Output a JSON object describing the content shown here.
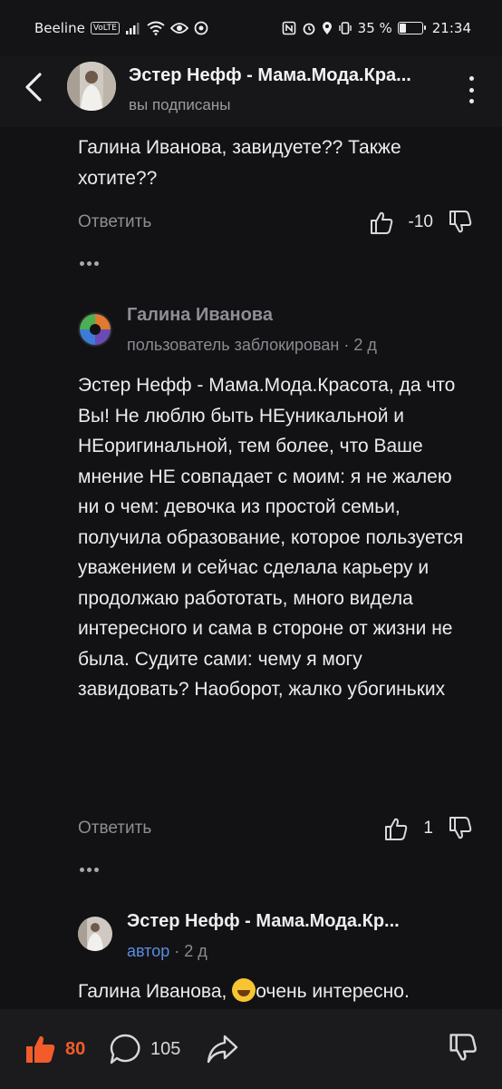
{
  "status": {
    "carrier": "Beeline",
    "volte": "VoLTE",
    "battery_percent_label": "35 %",
    "battery_level": 0.35,
    "time": "21:34"
  },
  "header": {
    "title": "Эстер Нефф - Мама.Мода.Кра...",
    "subtitle": "вы подписаны"
  },
  "comments": [
    {
      "text": "Галина Иванова, завидуете?? Также хотите??",
      "reply_label": "Ответить",
      "rating": "-10"
    },
    {
      "author": "Галина Иванова",
      "meta_status": "пользователь заблокирован",
      "meta_time": "· 2 д",
      "text": "Эстер Нефф - Мама.Мода.Красота, да что Вы! Не люблю быть НЕуникальной и НЕоригинальной, тем более, что Ваше мнение НЕ совпадает с моим: я не жалею ни о чем: девочка из простой семьи, получила образование, которое пользуется уважением и сейчас сделала карьеру и продолжаю работотать, много видела интересного и сама в стороне от жизни не была. Судите сами: чему я могу завидовать? Наоборот, жалко убогиньких",
      "reply_label": "Ответить",
      "rating": "1"
    },
    {
      "author": "Эстер Нефф - Мама.Мода.Кр...",
      "meta_status": "автор",
      "meta_time": "· 2 д",
      "text_prefix": "Галина Иванова, ",
      "text_suffix": "очень интересно."
    }
  ],
  "bottom_bar": {
    "like_count": "80",
    "comment_count": "105"
  },
  "colors": {
    "accent_orange": "#f25c2a",
    "author_blue": "#5a8de0",
    "background": "#121215"
  }
}
